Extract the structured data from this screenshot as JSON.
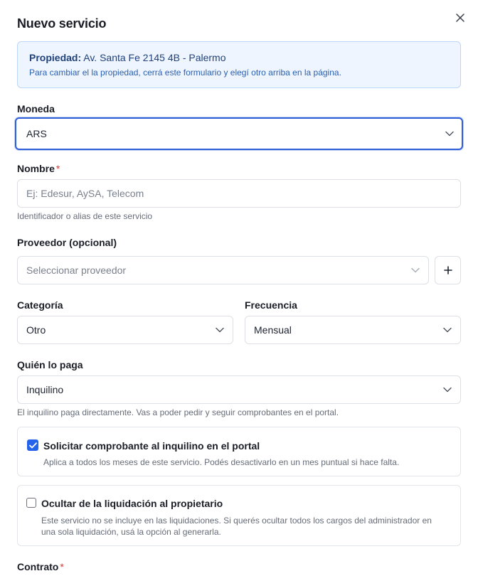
{
  "modal": {
    "title": "Nuevo servicio"
  },
  "info": {
    "property_label": "Propiedad:",
    "property_value": "Av. Santa Fe 2145 4B - Palermo",
    "hint": "Para cambiar el la propiedad, cerrá este formulario y elegí otro arriba en la página."
  },
  "moneda": {
    "label": "Moneda",
    "value": "ARS"
  },
  "nombre": {
    "label": "Nombre",
    "required": "*",
    "placeholder": "Ej: Edesur, AySA, Telecom",
    "help": "Identificador o alias de este servicio"
  },
  "proveedor": {
    "label": "Proveedor (opcional)",
    "placeholder": "Seleccionar proveedor",
    "add_label": "+"
  },
  "categoria": {
    "label": "Categoría",
    "value": "Otro"
  },
  "frecuencia": {
    "label": "Frecuencia",
    "value": "Mensual"
  },
  "quien_paga": {
    "label": "Quién lo paga",
    "value": "Inquilino",
    "help": "El inquilino paga directamente. Vas a poder pedir y seguir comprobantes en el portal."
  },
  "solicitar": {
    "checked": true,
    "title": "Solicitar comprobante al inquilino en el portal",
    "desc": "Aplica a todos los meses de este servicio. Podés desactivarlo en un mes puntual si hace falta."
  },
  "ocultar": {
    "checked": false,
    "title": "Ocultar de la liquidación al propietario",
    "desc": "Este servicio no se incluye en las liquidaciones. Si querés ocultar todos los cargos del administrador en una sola liquidación, usá la opción al generarla."
  },
  "contrato": {
    "label": "Contrato",
    "required": "*"
  },
  "colors": {
    "accent": "#2563eb",
    "focus_border": "#2f5fd8",
    "info_bg": "#eef5fe",
    "required": "#d93535"
  }
}
